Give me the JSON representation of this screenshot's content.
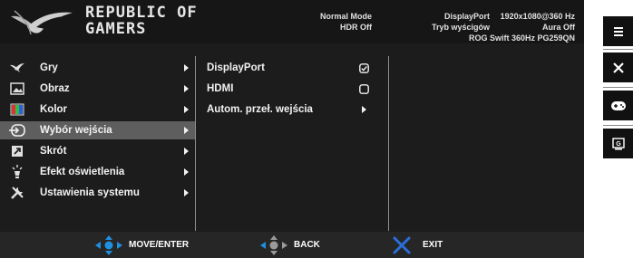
{
  "header": {
    "brand_line1": "REPUBLIC OF",
    "brand_line2": "GAMERS",
    "mode": "Normal Mode",
    "hdr": "HDR Off",
    "input": "DisplayPort",
    "game_mode": "Tryb wyścigów",
    "resolution": "1920x1080@360 Hz",
    "aura": "Aura Off",
    "model": "ROG Swift 360Hz PG259QN"
  },
  "menu": {
    "items": [
      {
        "label": "Gry",
        "icon": "gamepad-icon"
      },
      {
        "label": "Obraz",
        "icon": "image-icon"
      },
      {
        "label": "Kolor",
        "icon": "color-icon"
      },
      {
        "label": "Wybór wejścia",
        "icon": "input-select-icon",
        "selected": true
      },
      {
        "label": "Skrót",
        "icon": "shortcut-icon"
      },
      {
        "label": "Efekt oświetlenia",
        "icon": "lighting-icon"
      },
      {
        "label": "Ustawienia systemu",
        "icon": "system-settings-icon"
      }
    ]
  },
  "submenu": {
    "items": [
      {
        "label": "DisplayPort",
        "control": "checked"
      },
      {
        "label": "HDMI",
        "control": "unchecked"
      },
      {
        "label": "Autom. przeł. wejścia",
        "control": "arrow"
      }
    ]
  },
  "footer": {
    "move_label": "MOVE/ENTER",
    "back_label": "BACK",
    "exit_label": "EXIT"
  },
  "colors": {
    "background": "#1c1c1c",
    "selected": "#5e5e5e",
    "nav_blue": "#1f8fe0",
    "exit_blue": "#2a6fdb"
  }
}
